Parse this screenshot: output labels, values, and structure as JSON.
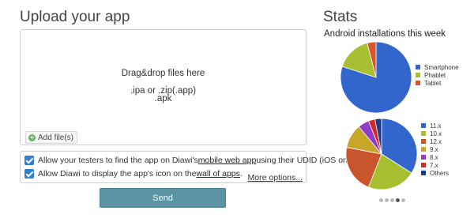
{
  "upload": {
    "title": "Upload your app",
    "drop_line1": "Drag&drop files here",
    "drop_line2": ".ipa or .zip(.app)",
    "drop_line3": ".apk",
    "add_files_label": "Add file(s)"
  },
  "options": {
    "opt1_pre": "Allow your testers to find the app on Diawi's ",
    "opt1_link": "mobile web app",
    "opt1_post": " using their UDID (iOS only).",
    "opt2_pre": "Allow Diawi to display the app's icon on the ",
    "opt2_link": "wall of apps",
    "opt2_post": ".",
    "more_options": "More options..."
  },
  "send_label": "Send",
  "stats": {
    "title": "Stats",
    "chart_title": "Android installations this week",
    "pager_total": 5,
    "pager_active": 4
  },
  "chart_data": [
    {
      "type": "pie",
      "categories": [
        "Smartphone",
        "Phablet",
        "Tablet"
      ],
      "values": [
        80,
        16,
        4
      ],
      "colors": [
        "#3366cc",
        "#a8bf31",
        "#d4562a"
      ]
    },
    {
      "type": "pie",
      "categories": [
        "11.x",
        "10.x",
        "12.x",
        "9.x",
        "8.x",
        "7.x",
        "Others"
      ],
      "values": [
        34,
        22,
        22,
        11,
        5,
        3,
        3
      ],
      "colors": [
        "#3366cc",
        "#a8bf31",
        "#c8552c",
        "#c8a62a",
        "#8e3cc8",
        "#d22a2a",
        "#1f3a8a"
      ]
    }
  ]
}
